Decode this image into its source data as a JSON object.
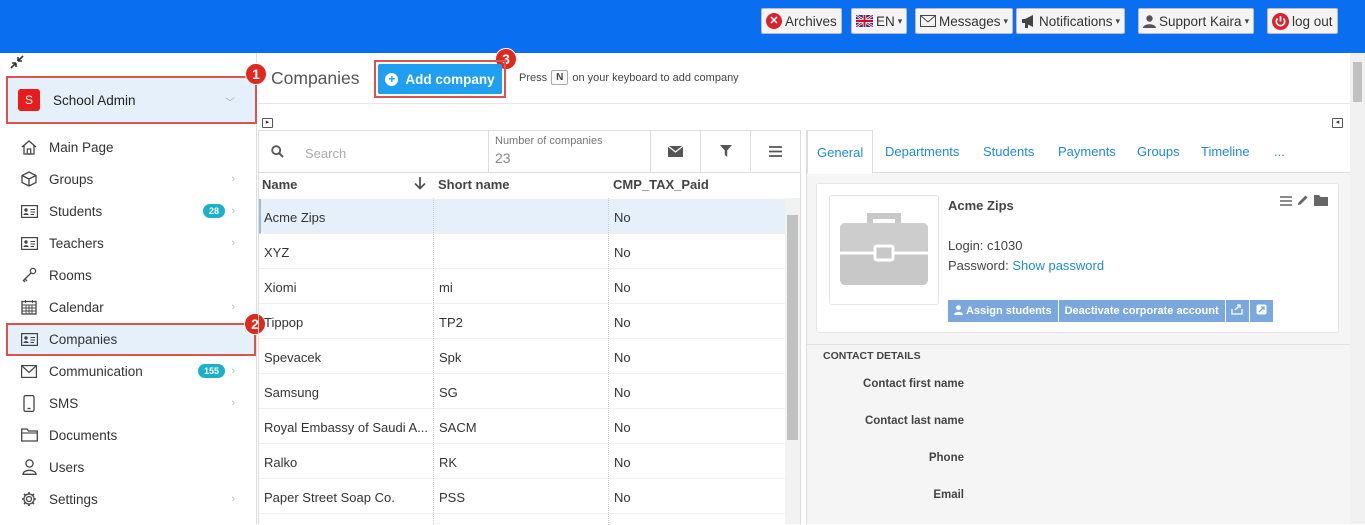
{
  "topbar": {
    "archives": "Archives",
    "language": "EN",
    "messages": "Messages",
    "notifications": "Notifications",
    "user": "Support Kaira",
    "logout": "log out"
  },
  "sidebar": {
    "school": {
      "avatar": "S",
      "label": "School Admin"
    },
    "items": [
      {
        "label": "Main Page",
        "icon": "home-icon"
      },
      {
        "label": "Groups",
        "icon": "cube-icon"
      },
      {
        "label": "Students",
        "icon": "id-card-icon",
        "badge": "28"
      },
      {
        "label": "Teachers",
        "icon": "id-card-icon"
      },
      {
        "label": "Rooms",
        "icon": "key-icon"
      },
      {
        "label": "Calendar",
        "icon": "calendar-icon"
      },
      {
        "label": "Companies",
        "icon": "id-card-icon"
      },
      {
        "label": "Communication",
        "icon": "envelope-icon",
        "badge": "155"
      },
      {
        "label": "SMS",
        "icon": "mobile-icon"
      },
      {
        "label": "Documents",
        "icon": "folder-icon"
      },
      {
        "label": "Users",
        "icon": "user-icon"
      },
      {
        "label": "Settings",
        "icon": "gear-icon"
      }
    ]
  },
  "markers": [
    "1",
    "2",
    "3"
  ],
  "header": {
    "title": "Companies",
    "add_button": "Add company",
    "press_prefix": "Press",
    "press_key": "N",
    "press_suffix": "on your keyboard to add company"
  },
  "list": {
    "search_placeholder": "Search",
    "count_label": "Number of companies",
    "count_value": "23",
    "columns": [
      "Name",
      "Short name",
      "CMP_TAX_Paid"
    ],
    "rows": [
      {
        "name": "Acme Zips",
        "short": "",
        "tax": "No"
      },
      {
        "name": "XYZ",
        "short": "",
        "tax": "No"
      },
      {
        "name": "Xiomi",
        "short": "mi",
        "tax": "No"
      },
      {
        "name": "Tippop",
        "short": "TP2",
        "tax": "No"
      },
      {
        "name": "Spevacek",
        "short": "Spk",
        "tax": "No"
      },
      {
        "name": "Samsung",
        "short": "SG",
        "tax": "No"
      },
      {
        "name": "Royal Embassy of Saudi A...",
        "short": "SACM",
        "tax": "No"
      },
      {
        "name": "Ralko",
        "short": "RK",
        "tax": "No"
      },
      {
        "name": "Paper Street Soap Co.",
        "short": "PSS",
        "tax": "No"
      }
    ]
  },
  "detail": {
    "tabs": [
      "General",
      "Departments",
      "Students",
      "Payments",
      "Groups",
      "Timeline",
      "..."
    ],
    "name": "Acme Zips",
    "login": "Login: c1030",
    "password_label": "Password:",
    "password_link": "Show password",
    "assign": "Assign students",
    "deactivate": "Deactivate corporate account",
    "contact_title": "CONTACT DETAILS",
    "contact_labels": [
      "Contact first name",
      "Contact last name",
      "Phone",
      "Email"
    ]
  }
}
